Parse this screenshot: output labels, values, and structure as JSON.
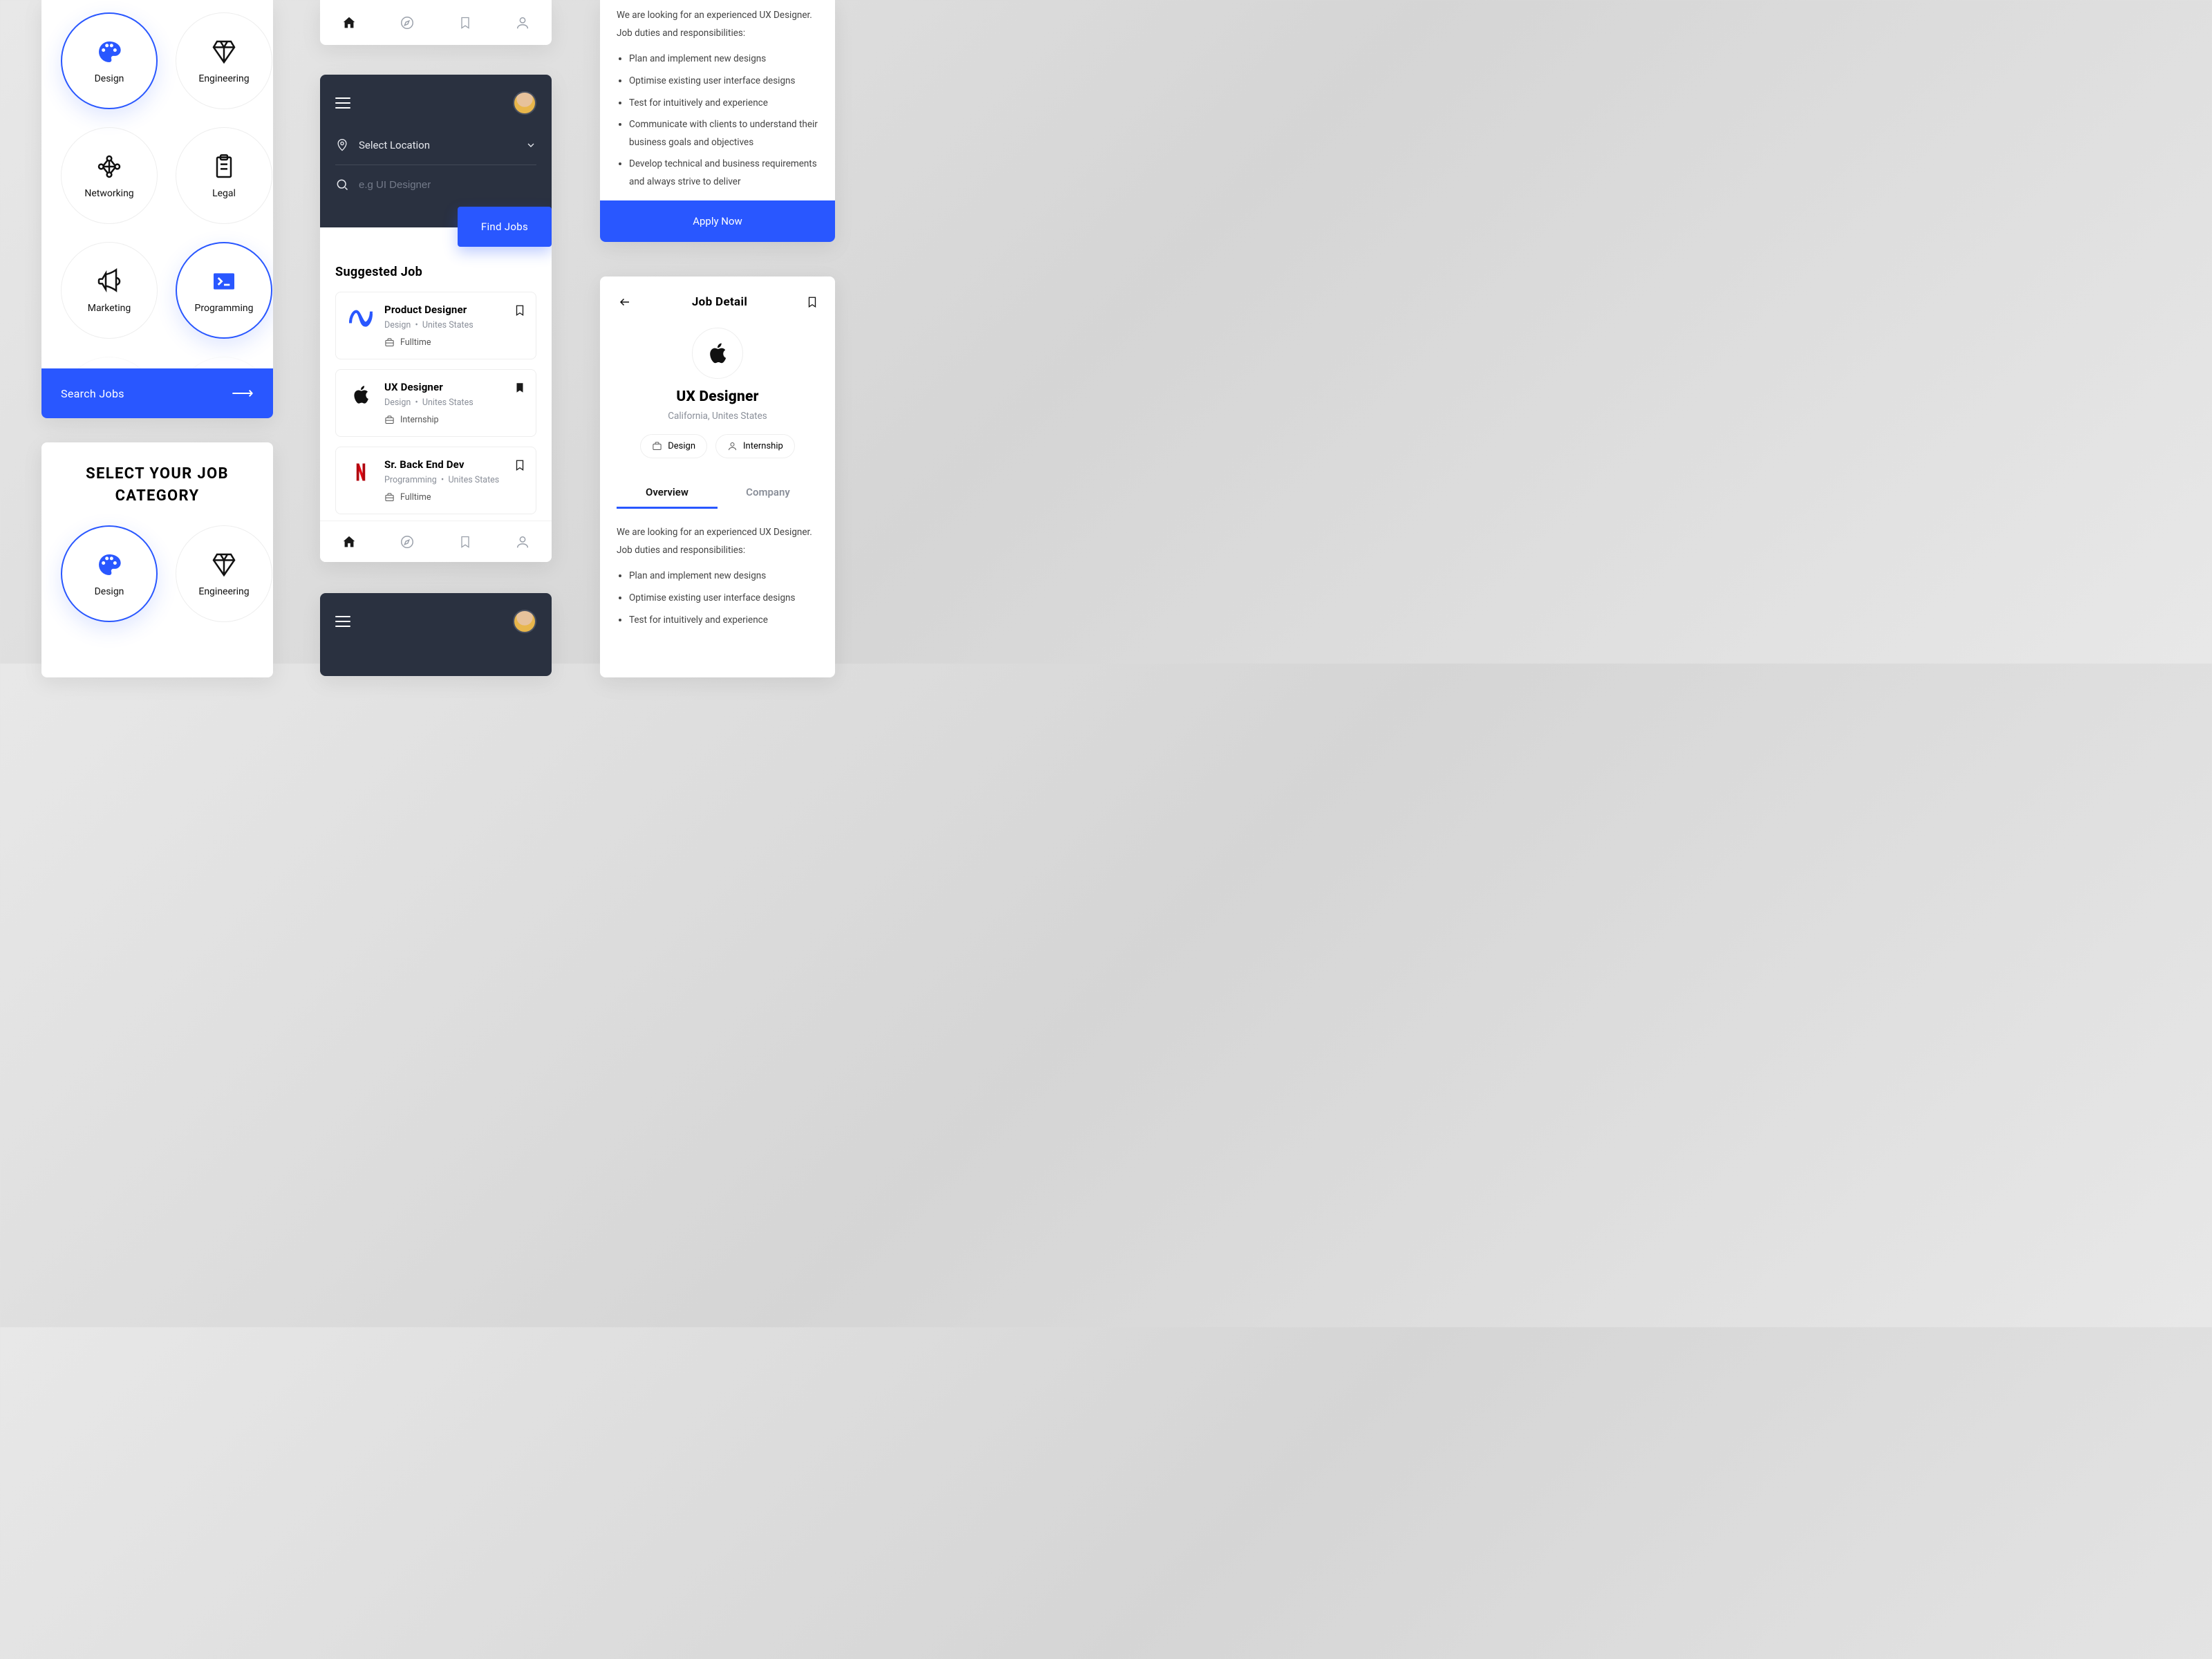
{
  "colors": {
    "accent": "#2957ff",
    "dark": "#2a3140"
  },
  "categories_screen": {
    "search_button": "Search Jobs",
    "categories": [
      {
        "label": "Design",
        "active": true
      },
      {
        "label": "Engineering",
        "active": false
      },
      {
        "label": "Networking",
        "active": false
      },
      {
        "label": "Legal",
        "active": false
      },
      {
        "label": "Marketing",
        "active": false
      },
      {
        "label": "Programming",
        "active": true
      }
    ]
  },
  "category_heading_screen": {
    "title": "SELECT YOUR JOB CATEGORY",
    "title_line1": "SELECT YOUR JOB",
    "title_line2": "CATEGORY",
    "categories": [
      {
        "label": "Design",
        "active": true
      },
      {
        "label": "Engineering",
        "active": false
      }
    ]
  },
  "nav_icons": [
    "home",
    "compass",
    "bookmark",
    "profile"
  ],
  "home_screen": {
    "location_placeholder": "Select Location",
    "search_placeholder": "e.g UI Designer",
    "find_button": "Find Jobs",
    "suggested_title": "Suggested Job",
    "jobs": [
      {
        "title": "Product Designer",
        "category": "Design",
        "location": "Unites States",
        "type": "Fulltime",
        "bookmarked": false,
        "logo": "meta"
      },
      {
        "title": "UX Designer",
        "category": "Design",
        "location": "Unites States",
        "type": "Internship",
        "bookmarked": true,
        "logo": "apple"
      },
      {
        "title": "Sr. Back End Dev",
        "category": "Programming",
        "location": "Unites States",
        "type": "Fulltime",
        "bookmarked": false,
        "logo": "netflix"
      }
    ]
  },
  "job_detail_text": {
    "intro": "We are looking for an experienced UX Designer. Job duties and responsibilities:",
    "bullets": [
      "Plan and implement new designs",
      "Optimise existing user interface designs",
      "Test for intuitively and experience",
      "Communicate with clients to understand their business goals and objectives",
      "Develop technical and business requirements and always strive to deliver"
    ],
    "apply_button": "Apply Now"
  },
  "job_detail_screen": {
    "header_title": "Job Detail",
    "job_title": "UX Designer",
    "job_location": "California, Unites States",
    "chip_category": "Design",
    "chip_type": "Internship",
    "tabs": [
      "Overview",
      "Company"
    ],
    "active_tab": 0,
    "intro": "We are looking for an experienced UX Designer. Job duties and responsibilities:",
    "bullets": [
      "Plan and implement new designs",
      "Optimise existing user interface designs",
      "Test for intuitively and experience"
    ]
  }
}
